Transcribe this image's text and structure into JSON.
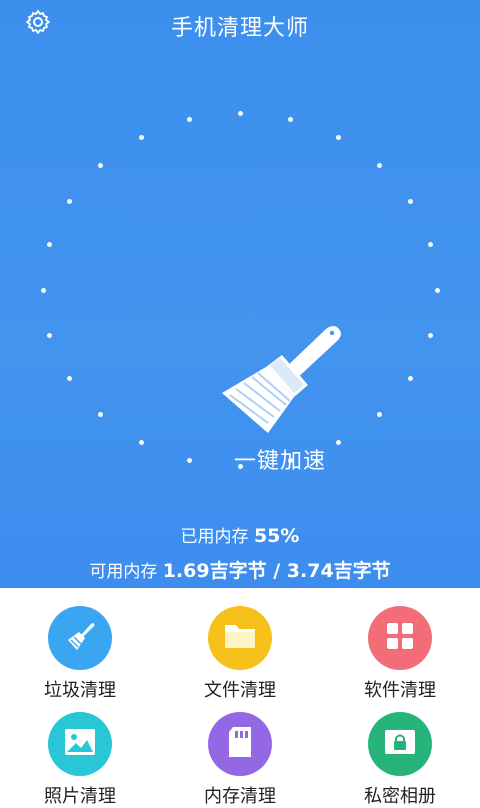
{
  "header": {
    "title": "手机清理大师",
    "settings_icon": "gear-icon"
  },
  "boost": {
    "label": "一键加速",
    "icon": "broom-icon"
  },
  "memory": {
    "used_label": "已用内存",
    "used_value": "55%",
    "available_label": "可用内存",
    "available_value": "1.69吉字节 / 3.74吉字节"
  },
  "tools": [
    {
      "label": "垃圾清理",
      "icon": "broom-icon",
      "color": "#3aa6f2"
    },
    {
      "label": "文件清理",
      "icon": "folder-icon",
      "color": "#f7c11c"
    },
    {
      "label": "软件清理",
      "icon": "apps-grid-icon",
      "color": "#f36d78"
    },
    {
      "label": "照片清理",
      "icon": "photo-icon",
      "color": "#28c6d6"
    },
    {
      "label": "内存清理",
      "icon": "sd-card-icon",
      "color": "#9467e4"
    },
    {
      "label": "私密相册",
      "icon": "lock-album-icon",
      "color": "#27b47a"
    }
  ],
  "colors": {
    "primary": "#3f92ef",
    "panel": "#ffffff"
  }
}
